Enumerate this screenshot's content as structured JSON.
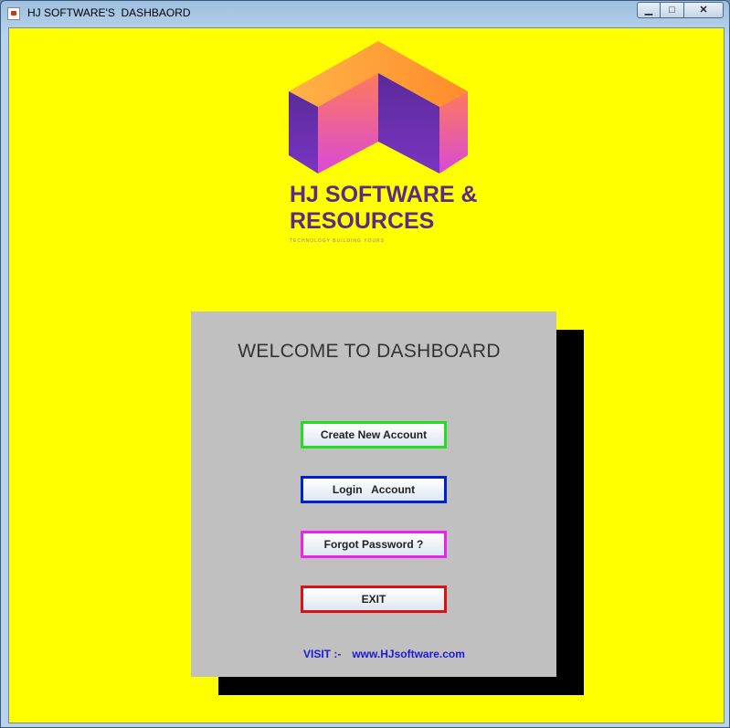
{
  "window": {
    "title": "HJ SOFTWARE'S  DASHBAORD",
    "minimize_glyph": "▁",
    "maximize_glyph": "□",
    "close_glyph": "✕"
  },
  "logo": {
    "name": "HJ SOFTWARE & RESOURCES",
    "line1": "HJ SOFTWARE &",
    "line2": "RESOURCES",
    "tagline": "TECHNOLOGY BUILDING YOURS"
  },
  "panel": {
    "heading": "WELCOME TO DASHBOARD",
    "buttons": {
      "create": "Create New Account",
      "login": "Login   Account",
      "forgot": "Forgot Password ?",
      "exit": "EXIT"
    },
    "visit_label": "VISIT :-",
    "visit_link": "www.HJsoftware.com"
  },
  "colors": {
    "background": "#ffff00",
    "panel": "#c0c0c0",
    "create_border": "#22dd22",
    "login_border": "#0022cc",
    "forgot_border": "#ee22ee",
    "exit_border": "#dd1111",
    "link": "#1a1ad6"
  }
}
